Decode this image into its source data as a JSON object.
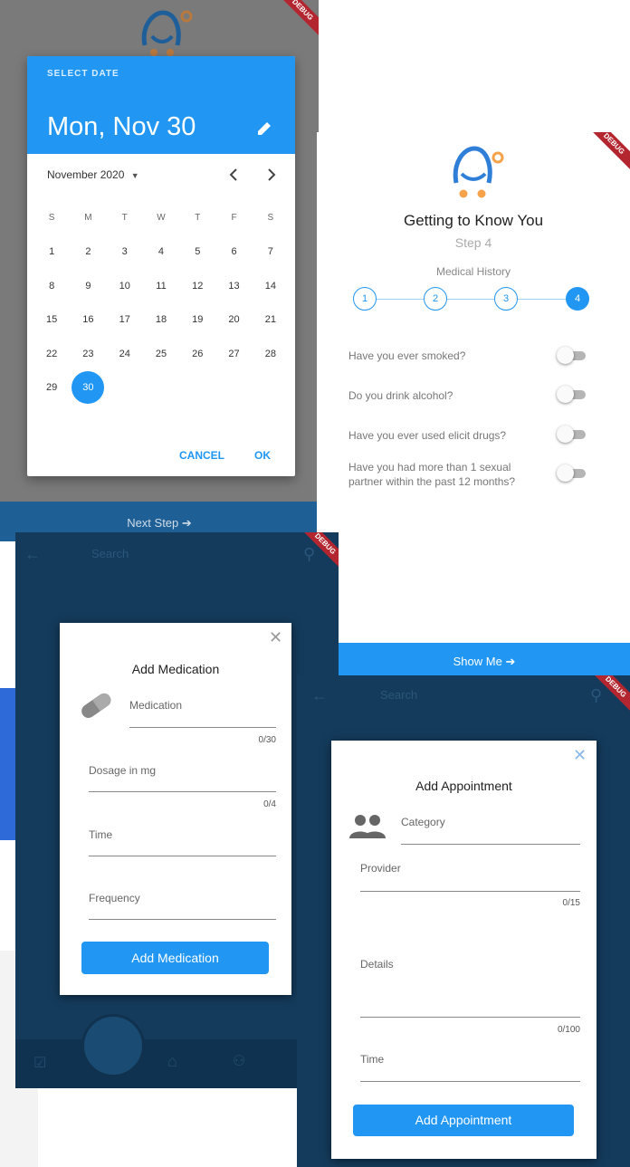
{
  "date_picker": {
    "debug": "DEBUG",
    "select_label": "SELECT DATE",
    "selected_date": "Mon, Nov 30",
    "month_year": "November 2020",
    "weekdays": [
      "S",
      "M",
      "T",
      "W",
      "T",
      "F",
      "S"
    ],
    "weeks": [
      [
        "1",
        "2",
        "3",
        "4",
        "5",
        "6",
        "7"
      ],
      [
        "8",
        "9",
        "10",
        "11",
        "12",
        "13",
        "14"
      ],
      [
        "15",
        "16",
        "17",
        "18",
        "19",
        "20",
        "21"
      ],
      [
        "22",
        "23",
        "24",
        "25",
        "26",
        "27",
        "28"
      ],
      [
        "29",
        "30",
        "",
        "",
        "",
        "",
        ""
      ]
    ],
    "selected_day": "30",
    "cancel_label": "CANCEL",
    "ok_label": "OK",
    "next_step_label": "Next Step"
  },
  "know_you": {
    "debug": "DEBUG",
    "title": "Getting to Know You",
    "step": "Step 4",
    "section": "Medical History",
    "steps": [
      "1",
      "2",
      "3",
      "4"
    ],
    "active_step": 4,
    "questions": [
      {
        "text": "Have you ever smoked?",
        "on": false
      },
      {
        "text": "Do you drink alcohol?",
        "on": false
      },
      {
        "text": "Have you ever used elicit drugs?",
        "on": false
      },
      {
        "text": "Have you had more than 1 sexual partner within the past 12 months?",
        "on": false
      }
    ],
    "show_me_label": "Show Me"
  },
  "add_medication": {
    "debug": "DEBUG",
    "search_placeholder": "Search",
    "title": "Add Medication",
    "fields": {
      "medication": {
        "label": "Medication",
        "counter": "0/30"
      },
      "dosage": {
        "label": "Dosage in mg",
        "counter": "0/4"
      },
      "time": {
        "label": "Time"
      },
      "frequency": {
        "label": "Frequency"
      }
    },
    "button_label": "Add Medication"
  },
  "add_appointment": {
    "debug": "DEBUG",
    "search_placeholder": "Search",
    "title": "Add Appointment",
    "fields": {
      "category": {
        "label": "Category"
      },
      "provider": {
        "label": "Provider",
        "counter": "0/15"
      },
      "details": {
        "label": "Details",
        "counter": "0/100"
      },
      "time": {
        "label": "Time"
      }
    },
    "button_label": "Add Appointment"
  },
  "colors": {
    "primary": "#2196f3",
    "dark_overlay": "#143b5c",
    "accent_orange": "#f5a24b",
    "debug_ribbon": "#b3262f"
  }
}
